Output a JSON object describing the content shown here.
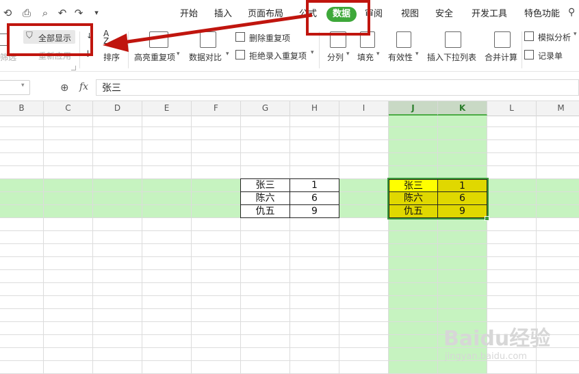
{
  "quick_access": {
    "icons": [
      "save-icon",
      "print-icon",
      "print-preview-icon",
      "undo-icon",
      "redo-icon",
      "customize-icon"
    ]
  },
  "tabs": [
    "开始",
    "插入",
    "页面布局",
    "公式",
    "数据",
    "审阅",
    "视图",
    "安全",
    "开发工具",
    "特色功能"
  ],
  "ribbon": {
    "show_all": "全部显示",
    "reapply": "重新应用",
    "filter_partial": "筛选",
    "sort": "排序",
    "highlight_dup": "高亮重复项",
    "data_compare": "数据对比",
    "remove_dup": "删除重复项",
    "reject_dup": "拒绝录入重复项",
    "split": "分列",
    "fill": "填充",
    "validity": "有效性",
    "dropdown": "插入下拉列表",
    "merge": "合并计算",
    "simulate": "模拟分析",
    "record": "记录单",
    "az": "A\nZ"
  },
  "formula_bar": {
    "fx": "fx",
    "value": "张三"
  },
  "columns": [
    "B",
    "C",
    "D",
    "E",
    "F",
    "G",
    "H",
    "I",
    "J",
    "K",
    "L",
    "M"
  ],
  "table_left": [
    [
      "张三",
      "1"
    ],
    [
      "陈六",
      "6"
    ],
    [
      "仇五",
      "9"
    ]
  ],
  "table_right": [
    [
      "张三",
      "1"
    ],
    [
      "陈六",
      "6"
    ],
    [
      "仇五",
      "9"
    ]
  ],
  "watermark": {
    "brand": "Baidu经验",
    "url": "jingyan.baidu.com"
  },
  "colors": {
    "accent": "#3ea83a",
    "highlight_row": "#c6f3c0",
    "selected_cells": "#e0d800",
    "annotation": "#c0150e"
  }
}
